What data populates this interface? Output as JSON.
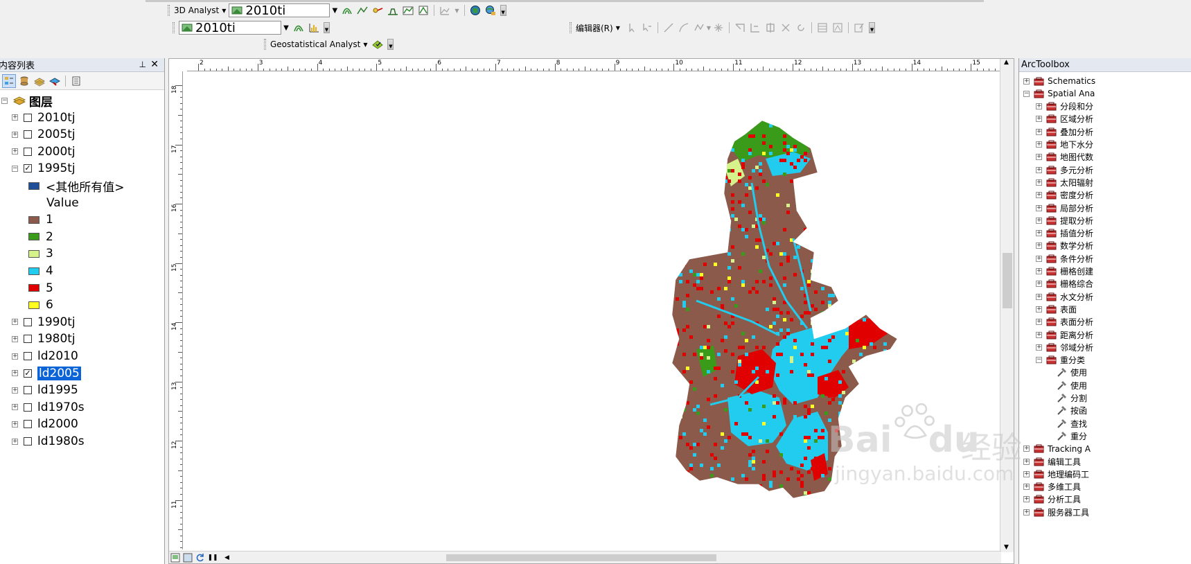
{
  "toolbars": {
    "analyst3d": {
      "label": "3D Analyst",
      "layer": "2010ti"
    },
    "layer_combo2": {
      "layer": "2010ti"
    },
    "editor": {
      "label": "编辑器(R)"
    },
    "geostat": {
      "label": "Geostatistical Analyst"
    }
  },
  "toc": {
    "title": "内容列表",
    "root_label": "图层",
    "items": [
      {
        "label": "2010tj",
        "checked": false,
        "expanded": false
      },
      {
        "label": "2005tj",
        "checked": false,
        "expanded": false
      },
      {
        "label": "2000tj",
        "checked": false,
        "expanded": false
      },
      {
        "label": "1995tj",
        "checked": true,
        "expanded": true
      },
      {
        "label": "1990tj",
        "checked": false,
        "expanded": false
      },
      {
        "label": "1980tj",
        "checked": false,
        "expanded": false
      },
      {
        "label": "ld2010",
        "checked": false,
        "expanded": false
      },
      {
        "label": "ld2005",
        "checked": true,
        "expanded": false,
        "selected": true
      },
      {
        "label": "ld1995",
        "checked": false,
        "expanded": false
      },
      {
        "label": "ld1970s",
        "checked": false,
        "expanded": false
      },
      {
        "label": "ld2000",
        "checked": false,
        "expanded": false
      },
      {
        "label": "ld1980s",
        "checked": false,
        "expanded": false
      }
    ],
    "legend": {
      "other_label": "<其他所有值>",
      "other_color": "#1f4e99",
      "field_label": "Value",
      "classes": [
        {
          "value": "1",
          "color": "#8b5a4a"
        },
        {
          "value": "2",
          "color": "#3a9a1a"
        },
        {
          "value": "3",
          "color": "#d6f28a"
        },
        {
          "value": "4",
          "color": "#22ccee"
        },
        {
          "value": "5",
          "color": "#e00000"
        },
        {
          "value": "6",
          "color": "#ffff22"
        }
      ]
    }
  },
  "rulers": {
    "top": [
      "2",
      "3",
      "4",
      "5",
      "6",
      "7",
      "8",
      "9",
      "10",
      "11",
      "12",
      "13",
      "14",
      "15"
    ],
    "left": [
      "18",
      "17",
      "16",
      "15",
      "14",
      "13",
      "12",
      "11"
    ]
  },
  "toolbox": {
    "title": "ArcToolbox",
    "items": [
      {
        "label": "Schematics",
        "kind": "box",
        "level": 0
      },
      {
        "label": "Spatial Ana",
        "kind": "box",
        "level": 0,
        "expanded": true
      },
      {
        "label": "分段和分",
        "kind": "box",
        "level": 1
      },
      {
        "label": "区域分析",
        "kind": "box",
        "level": 1
      },
      {
        "label": "叠加分析",
        "kind": "box",
        "level": 1
      },
      {
        "label": "地下水分",
        "kind": "box",
        "level": 1
      },
      {
        "label": "地图代数",
        "kind": "box",
        "level": 1
      },
      {
        "label": "多元分析",
        "kind": "box",
        "level": 1
      },
      {
        "label": "太阳辐射",
        "kind": "box",
        "level": 1
      },
      {
        "label": "密度分析",
        "kind": "box",
        "level": 1
      },
      {
        "label": "局部分析",
        "kind": "box",
        "level": 1
      },
      {
        "label": "提取分析",
        "kind": "box",
        "level": 1
      },
      {
        "label": "插值分析",
        "kind": "box",
        "level": 1
      },
      {
        "label": "数学分析",
        "kind": "box",
        "level": 1
      },
      {
        "label": "条件分析",
        "kind": "box",
        "level": 1
      },
      {
        "label": "栅格创建",
        "kind": "box",
        "level": 1
      },
      {
        "label": "栅格综合",
        "kind": "box",
        "level": 1
      },
      {
        "label": "水文分析",
        "kind": "box",
        "level": 1
      },
      {
        "label": "表面",
        "kind": "box",
        "level": 1
      },
      {
        "label": "表面分析",
        "kind": "box",
        "level": 1
      },
      {
        "label": "距离分析",
        "kind": "box",
        "level": 1
      },
      {
        "label": "邻域分析",
        "kind": "box",
        "level": 1
      },
      {
        "label": "重分类",
        "kind": "box",
        "level": 1,
        "expanded": true
      },
      {
        "label": "使用",
        "kind": "tool",
        "level": 2
      },
      {
        "label": "使用",
        "kind": "tool",
        "level": 2
      },
      {
        "label": "分割",
        "kind": "tool",
        "level": 2
      },
      {
        "label": "按函",
        "kind": "tool",
        "level": 2
      },
      {
        "label": "查找",
        "kind": "tool",
        "level": 2
      },
      {
        "label": "重分",
        "kind": "tool",
        "level": 2
      },
      {
        "label": "Tracking A",
        "kind": "box",
        "level": 0
      },
      {
        "label": "编辑工具",
        "kind": "box",
        "level": 0
      },
      {
        "label": "地理编码工",
        "kind": "box",
        "level": 0
      },
      {
        "label": "多维工具",
        "kind": "box",
        "level": 0
      },
      {
        "label": "分析工具",
        "kind": "box",
        "level": 0
      },
      {
        "label": "服务器工具",
        "kind": "box",
        "level": 0
      }
    ]
  },
  "watermark": {
    "brand": "Bai",
    "brand2": "du",
    "cn": "经验",
    "url": "jingyan.baidu.com"
  }
}
